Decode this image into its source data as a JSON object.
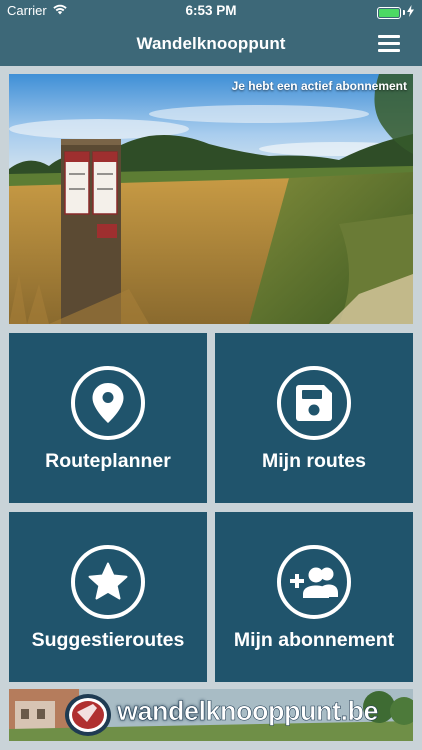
{
  "status_bar": {
    "carrier": "Carrier",
    "time": "6:53 PM",
    "wifi_icon": "wifi-icon",
    "battery_icon": "battery-icon",
    "charging_icon": "bolt-icon"
  },
  "nav": {
    "title": "Wandelknooppunt",
    "menu_icon": "hamburger-menu-icon"
  },
  "hero": {
    "subscription_status": "Je hebt een actief abonnement"
  },
  "tiles": [
    {
      "label": "Routeplanner",
      "icon": "map-pin-icon"
    },
    {
      "label": "Mijn routes",
      "icon": "save-disk-icon"
    },
    {
      "label": "Suggestieroutes",
      "icon": "star-icon"
    },
    {
      "label": "Mijn abonnement",
      "icon": "add-group-icon"
    }
  ],
  "banner": {
    "brand_part1": "wandel",
    "brand_part2": "knooppunt",
    "brand_part3": ".be"
  },
  "colors": {
    "header": "#3d6878",
    "tile": "#20546c",
    "background": "#c9d3d8",
    "battery_fill": "#4cd964"
  }
}
